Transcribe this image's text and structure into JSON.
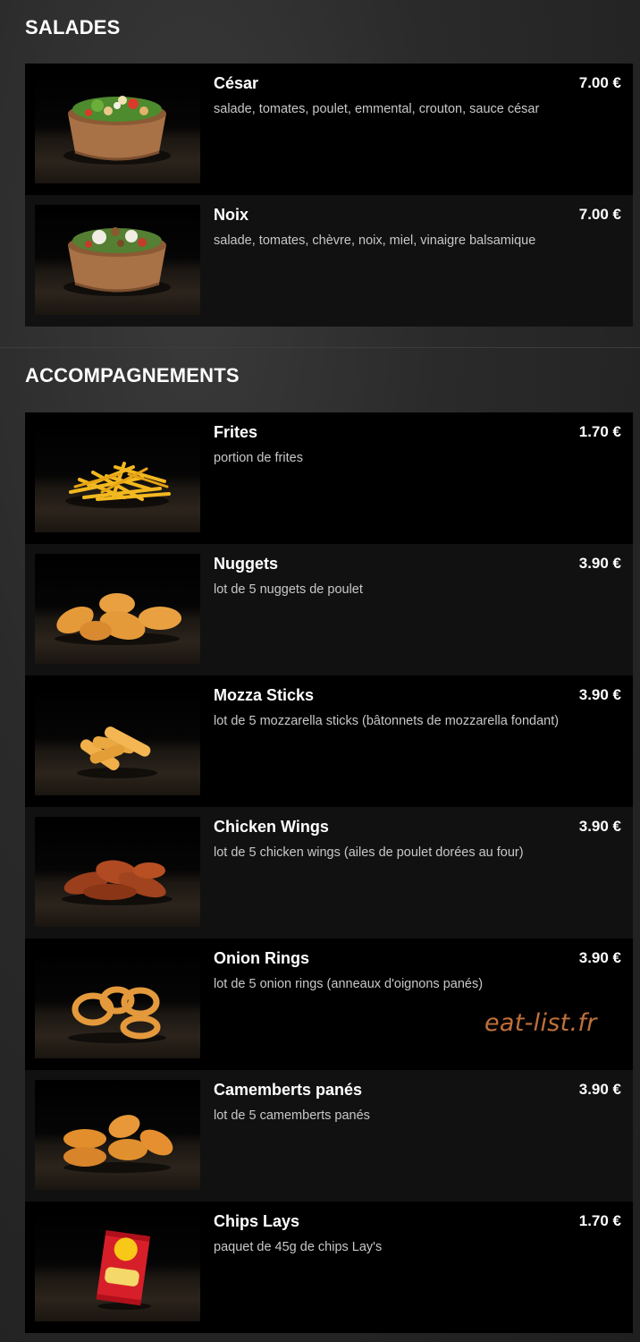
{
  "sections": [
    {
      "title": "SALADES",
      "items": [
        {
          "name": "César",
          "price": "7.00 €",
          "desc": "salade, tomates, poulet, emmental, crouton, sauce césar",
          "image": "caesar-salad-bowl"
        },
        {
          "name": "Noix",
          "price": "7.00 €",
          "desc": "salade, tomates, chèvre, noix, miel, vinaigre balsamique",
          "image": "walnut-salad-bowl"
        }
      ]
    },
    {
      "title": "ACCOMPAGNEMENTS",
      "items": [
        {
          "name": "Frites",
          "price": "1.70 €",
          "desc": "portion de frites",
          "image": "fries"
        },
        {
          "name": "Nuggets",
          "price": "3.90 €",
          "desc": "lot de 5 nuggets de poulet",
          "image": "nuggets"
        },
        {
          "name": "Mozza Sticks",
          "price": "3.90 €",
          "desc": "lot de 5 mozzarella sticks (bâtonnets de mozzarella fondant)",
          "image": "mozza-sticks"
        },
        {
          "name": "Chicken Wings",
          "price": "3.90 €",
          "desc": "lot de 5 chicken wings (ailes de poulet dorées au four)",
          "image": "chicken-wings"
        },
        {
          "name": "Onion Rings",
          "price": "3.90 €",
          "desc": "lot de 5 onion rings (anneaux d'oignons panés)",
          "image": "onion-rings"
        },
        {
          "name": "Camemberts panés",
          "price": "3.90 €",
          "desc": "lot de 5 camemberts panés",
          "image": "breaded-camembert"
        },
        {
          "name": "Chips Lays",
          "price": "1.70 €",
          "desc": "paquet de 45g de chips Lay's",
          "image": "lays-chips-bag"
        }
      ]
    }
  ],
  "watermark": "eat-list.fr",
  "colors": {
    "row_dark": "#000000",
    "row_light": "#111111",
    "watermark": "#c0703a",
    "background": "#262626"
  }
}
